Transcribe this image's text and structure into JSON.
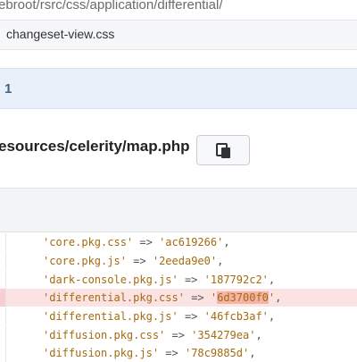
{
  "breadcrumb": {
    "path": "ebroot/rsrc/css/application/differential/"
  },
  "file_tab": {
    "name": "changeset-view.css"
  },
  "diff_header": {
    "number": "1"
  },
  "resource_header": {
    "title": "esources/celerity/map.php"
  },
  "copy_button": {
    "icon": "clipboard-icon"
  },
  "code_lines": [
    {
      "key": "'core.pkg.css'",
      "arrow": "=>",
      "value": "'ac619266'",
      "tail": ",",
      "status": "normal"
    },
    {
      "key": "'core.pkg.js'",
      "arrow": "=>",
      "value": "'2eeda9e0'",
      "tail": ",",
      "status": "normal"
    },
    {
      "key": "'dark-console.pkg.js'",
      "arrow": "=>",
      "value": "'187792c2'",
      "tail": ",",
      "status": "normal"
    },
    {
      "key": "'differential.pkg.css'",
      "arrow": "=>",
      "value_pre": "'",
      "value_hl": "6d3700f0",
      "value_post": "'",
      "tail": ",",
      "status": "removed"
    },
    {
      "key": "'differential.pkg.js'",
      "arrow": "=>",
      "value": "'46fcb3af'",
      "tail": ",",
      "status": "normal"
    },
    {
      "key": "'diffusion.pkg.css'",
      "arrow": "=>",
      "value": "'354279ea'",
      "tail": ",",
      "status": "normal"
    },
    {
      "key": "'diffusion.pkg.js'",
      "arrow": "=>",
      "value": "'78c9885d'",
      "tail": ",",
      "status": "normal"
    }
  ],
  "colors": {
    "removed_line_bg": "#fbe3e4",
    "removed_highlight": "#f4b4a6",
    "header_band_bg": "#e9f0f9",
    "string_color": "#a46b10"
  }
}
